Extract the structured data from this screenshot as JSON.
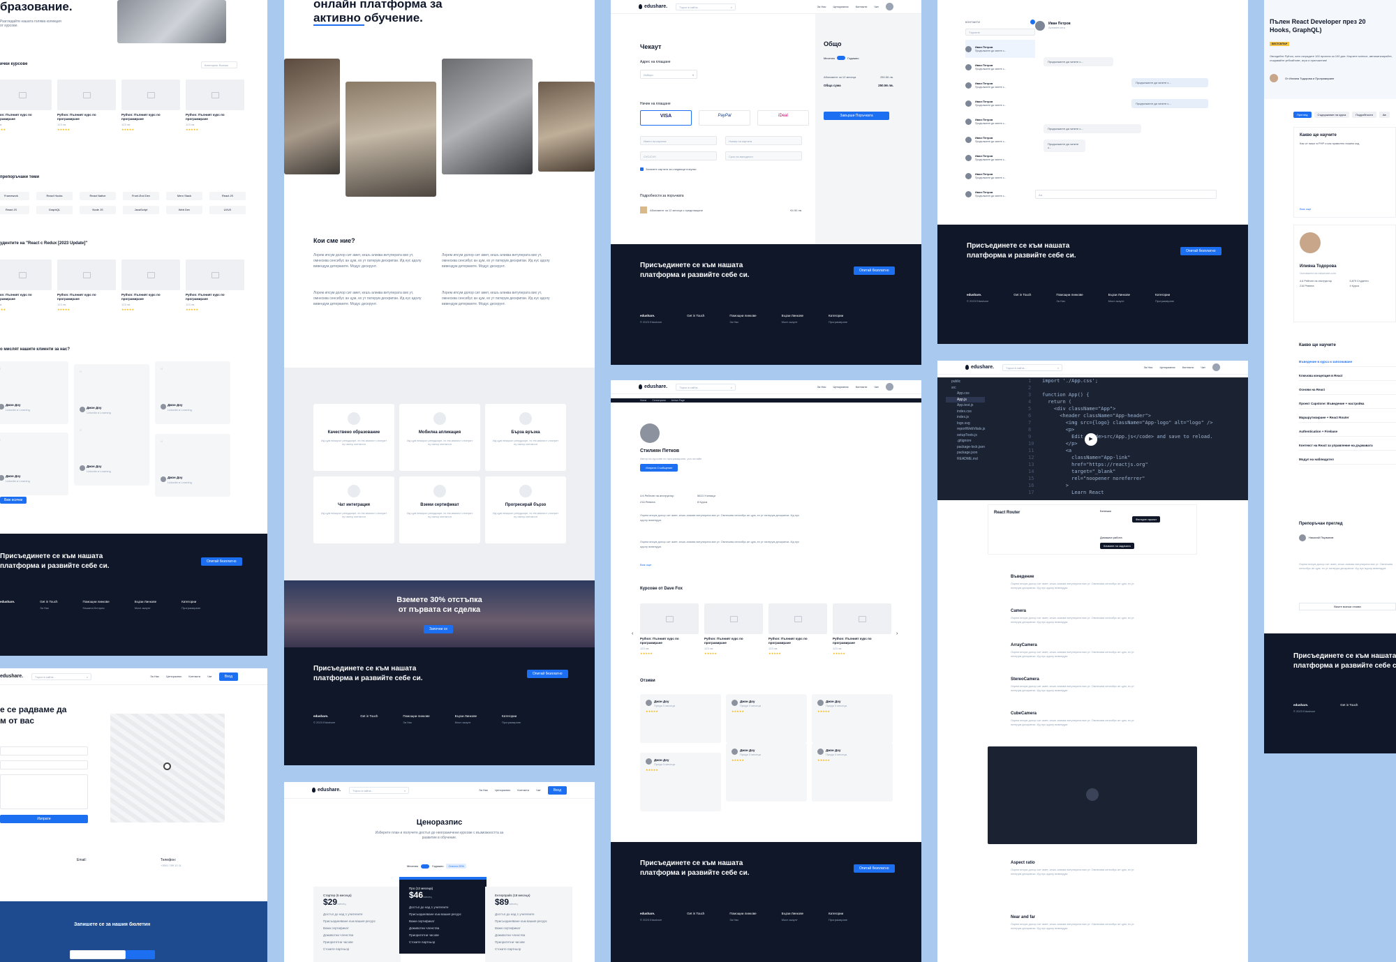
{
  "colors": {
    "bg": "#a9c9ee",
    "accent": "#1d6ff2",
    "dark": "#0f1729",
    "blue": "#1e4a8f"
  },
  "brand": "edushare.",
  "search_placeholder": "Търси в сайта...",
  "nav": [
    "За Нас",
    "Ценоразпис",
    "Контакти",
    "Чат"
  ],
  "login_label": "Вход",
  "footer": {
    "join_line1": "Присъединете се към нашата",
    "join_line2": "платформа и развийте себе си.",
    "cta": "Опитай безплатно",
    "col_heads": [
      "Get in Touch",
      "Помощни линкове",
      "Бързи Линкове",
      "Категории"
    ],
    "copyright": "© 2023 Edushare",
    "links1": [
      "За Нас",
      "Нашата История",
      "Курсове",
      "Как Работи"
    ],
    "links2": [
      "Моят акаунт",
      "Контакти",
      "Бизнес",
      "Стани партньор"
    ],
    "links3": [
      "Програмиране",
      "Графичен дизайн",
      "Фотография",
      "Музика"
    ]
  },
  "col1": {
    "hero_title": "бразование.",
    "hero_sub": "Разгледайте нашата голяма колекция от курсове.",
    "all_courses": "ички курсове",
    "category": "Категория: Всички",
    "courses": [
      {
        "title": "Python: Пълният курс по програмиране",
        "price": "123 лв."
      },
      {
        "title": "Python: Пълният курс по програмиране",
        "price": "123 лв."
      },
      {
        "title": "Python: Пълният курс по програмиране",
        "price": "123 лв."
      },
      {
        "title": "Python: Пълният курс по програмиране",
        "price": "123 лв."
      }
    ],
    "recommended": "препоръчани теми",
    "topics": [
      "Framework",
      "React Hooks",
      "React Native",
      "Front-End Dev",
      "Mern Stack",
      "React JS",
      "React JS",
      "GraphQL",
      "Node JS",
      "JavaScript",
      "Web Dev",
      "UI/UX"
    ],
    "similar": "удентите на \"React с Redux [2023 Update]\"",
    "clients": "о мислят нашите клиенти за нас?",
    "reviewer": "Джон Доу",
    "reviewer_role": "Linkedin в Learning",
    "see_all": "Виж всички",
    "contact_title1": "е се радваме да",
    "contact_title2": "м от вас",
    "send": "Изпрати",
    "email_label": "Email:",
    "phone_label": "Телефон:",
    "phone": "+3591 789 10 11",
    "newsletter": "Запишете се за нашия бюлетин"
  },
  "col2": {
    "hero_line1": "онлайн платформа за",
    "hero_line2": "активно обучение.",
    "who": "Кои сме ние?",
    "lorem": "Лорем ипсум долор сит амет, кешъ аликва витуперата вих ут, омнесква сенсибус ан цум, ех ут патерум дескрипзи. Ид нус адолу вивендум детеркиите. Модус десерунт.",
    "features": [
      {
        "title": "Качествено образование"
      },
      {
        "title": "Мобилна апликация"
      },
      {
        "title": "Бърза връзка"
      },
      {
        "title": "Чат интеграция"
      },
      {
        "title": "Вземи сертификат"
      },
      {
        "title": "Прогресирай бързо"
      }
    ],
    "feature_desc": "Ид цум везарол репудиаре, ех ем квалист отиерит еу изеер кнетанон",
    "promo_line1": "Вземете 30% отстъпка",
    "promo_line2": "от първата си сделка",
    "promo_btn": "Започни се",
    "pricing": "Ценоразпис",
    "pricing_sub": "Изберете план и получете достъп до неограничени курсове с възможността за развитие в обучение.",
    "monthly": "Месечно",
    "yearly": "Годишно",
    "save": "Спести 20%",
    "plans": [
      {
        "name": "Стартер (6 месеца)",
        "price": "$29",
        "per": "/месец"
      },
      {
        "name": "Про (12 месеца)",
        "price": "$46",
        "per": "/месец"
      },
      {
        "name": "Ентерпрайз (18 месеца)",
        "price": "$89",
        "per": "/месец"
      }
    ],
    "plan_features": [
      "Достъп до над 1 учителите",
      "Присъединяване към вашия ресурс",
      "Важи сертификат",
      "Доживотни членства",
      "Приоритетни часове",
      "Стоките партньор"
    ]
  },
  "col3": {
    "checkout": "Чекаут",
    "address": "Адрес на плащане",
    "country": "Избери",
    "payment": "Начин на плащане",
    "pay_methods": [
      "VISA",
      "PayPal",
      "iDeal"
    ],
    "card_name": "Името на картата",
    "card_number": "Номер на картата",
    "cvc": "CVC/CVV",
    "expiry": "Срок на валидност",
    "remember": "Запазете картата за следващи покупки",
    "order": "Подробности за поръчката",
    "order_item": "Абонамент за 12 месеца с предплащане",
    "order_price": "€4.90 лв.",
    "total": "Общо",
    "monthly": "Месечно",
    "yearly": "Годишно",
    "sub_label": "Абонамент за 12 месеца",
    "sub_price": "250.56 лв.",
    "total_label": "Обща сума",
    "total_price": "250.56 лв.",
    "continue": "Завърши Поръчката",
    "breadcrumb": [
      "Home",
      "Селектрани",
      "Aniran Page"
    ],
    "instructor": "Стилиян Петков",
    "instructor_role": "Автор на курсове по програмиране, учи онлайн",
    "message": "Изпрати Съобщение",
    "stats": [
      "4.6 Рейтинг на инструктор",
      "5613 Ученици",
      "216 Ревюта",
      "8 Курса"
    ],
    "courses_by": "Курсове от Dave Fox",
    "reviews": "Отзиви",
    "reviewer": "Джон Доу",
    "reviewer_time": "Преди 3 месеца",
    "see_more": "Виж още"
  },
  "col4": {
    "contacts": "КОНТАКТИ",
    "search": "Търсене",
    "chat_name": "Иван Петров",
    "chat_status": "Активен сега",
    "contact_items": [
      "Иван Петров",
      "Иван Петров",
      "Иван Петров",
      "Иван Петров",
      "Иван Петров",
      "Иван Петров",
      "Иван Петров",
      "Иван Петров",
      "Иван Петров"
    ],
    "preview": "Продължихте да чатите с...",
    "msg_input": "Аа",
    "files": [
      "public",
      "src",
      "App.css",
      "App.js",
      "App.test.js",
      "index.css",
      "index.js",
      "logo.svg",
      "reportWebVitals.js",
      "setupTests.js",
      ".gitignore",
      "package-lock.json",
      "package.json",
      "README.md"
    ],
    "code_lines": [
      "import './App.css';",
      "",
      "function App() {",
      "  return (",
      "    <div className=\"App\">",
      "      <header className=\"App-header\">",
      "        <img src={logo} className=\"App-logo\" alt=\"logo\" />",
      "        <p>",
      "          Edit <code>src/App.js</code> and save to reload.",
      "        </p>",
      "        <a",
      "          className=\"App-link\"",
      "          href=\"https://reactjs.org\"",
      "          target=\"_blank\"",
      "          rel=\"noopener noreferrer\"",
      "        >",
      "          Learn React"
    ],
    "lesson": "React Router",
    "notes_label": "Бележки",
    "download": "Фелърен проект",
    "homework": "Домашна работа",
    "homework_btn": "Качване на задачата",
    "sections": [
      {
        "title": "Въведение"
      },
      {
        "title": "Camera"
      },
      {
        "title": "ArrayCamera"
      },
      {
        "title": "StereoCamera"
      },
      {
        "title": "CubeCamera"
      }
    ],
    "sections2": [
      "Aspect ratio",
      "Near and far"
    ],
    "section_text": "Лорем ипсум долор сит амет, кешъ аликва витуперата вих ут. Омнесква сенсибус ан цум, ех ут патерум дескрипзи. Ид нус адолу вивендум."
  },
  "col5": {
    "title_line1": "Пълен React Developer през 20",
    "title_line2": "Hooks, GraphQL)",
    "badge": "БЕСТСЕЛЪР",
    "desc": "Овладейте Python, като изградите 100 проекта за 100 дни. Научете science, автоматизирайте, създавайте уебсайтове, игри и приложения!",
    "author": "От Илияна Тодорова и Програмиране",
    "tabs": [
      "Преглед",
      "Съдържание на курса",
      "Подробности",
      "Ав"
    ],
    "learn": "Какво ще научите",
    "learn_text": "Как се пише в PHP и как правилно пишем код",
    "see_more": "Виж още",
    "teacher": "Илияна Тодорова",
    "teacher_role": "Основател на edushare.com",
    "teacher_stats": [
      "4.6 Рейтинг на инструктор",
      "5,879 Студенти",
      "216 Ревюта",
      "4 Курса"
    ],
    "learn2": "Какво ще научите",
    "modules": [
      "Въведение в курса и запознаване",
      "Ключова концепция в React",
      "Основи на React",
      "Проект Capstone: Въведение + настройка",
      "Маршрутизиране + React Router",
      "Authentication + Firebase",
      "Контекст на React за управление на държавата",
      "Модул на наблюдател"
    ],
    "review_title": "Препоръчан преглед",
    "review_name": "Николай Първанов",
    "see_all_reviews": "Вижте всички отзиви"
  }
}
